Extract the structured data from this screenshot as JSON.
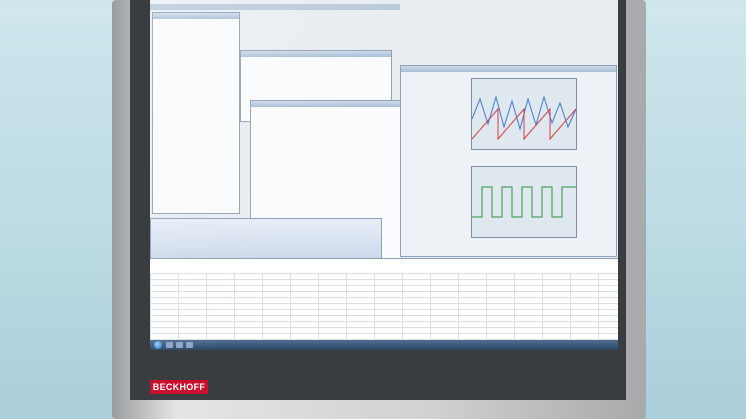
{
  "brand": {
    "logo_text": "BECKHOFF",
    "logo_color": "#c8102e"
  },
  "colors": {
    "background": "#bcdbe4",
    "bezel": "#cfd1d2",
    "screen": "#e9edf2"
  },
  "icons": [
    "windows-start-orb-icon",
    "taskbar-app-icon",
    "folder-tree-icon"
  ]
}
